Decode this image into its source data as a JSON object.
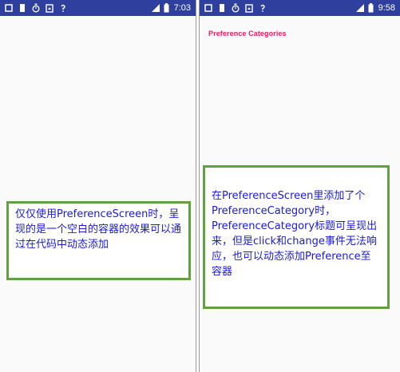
{
  "left_phone": {
    "status_bar": {
      "icons": [
        "square-icon",
        "sd-card-icon",
        "clock-icon",
        "image-icon",
        "wifi-question-icon"
      ],
      "time": "7:03",
      "battery_icon": "battery-icon",
      "signal_icon": "signal-icon"
    },
    "annotation": "仅仅使用PreferenceScreen时，呈现的是一个空白的容器的效果可以通过在代码中动态添加"
  },
  "right_phone": {
    "status_bar": {
      "icons": [
        "square-icon",
        "sd-card-icon",
        "clock-icon",
        "image-icon",
        "wifi-question-icon"
      ],
      "time": "9:58",
      "battery_icon": "battery-icon",
      "signal_icon": "signal-icon"
    },
    "category_title": "Preference Categories",
    "annotation": "在PreferenceScreen里添加了个PreferenceCategory时，PreferenceCategory标题可呈现出来，但是click和change事件无法响应，也可以动态添加Preference至容器"
  },
  "colors": {
    "status_bar": "#2e3f9e",
    "category_title": "#e91e63",
    "annotation_text": "#1a1ad6",
    "annotation_border": "#62a041"
  }
}
